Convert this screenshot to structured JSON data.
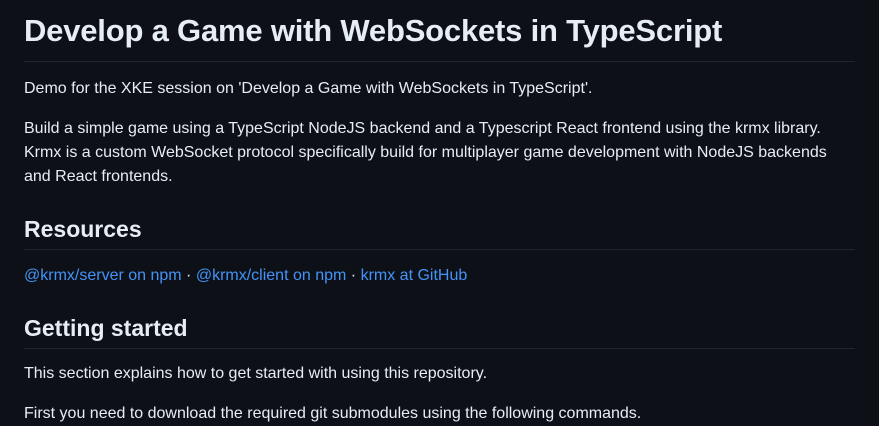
{
  "readme": {
    "title": "Develop a Game with WebSockets in TypeScript",
    "intro": "Demo for the XKE session on 'Develop a Game with WebSockets in TypeScript'.",
    "description": "Build a simple game using a TypeScript NodeJS backend and a Typescript React frontend using the krmx library. Krmx is a custom WebSocket protocol specifically build for multiplayer game development with NodeJS backends and React frontends.",
    "resources": {
      "heading": "Resources",
      "separator": " · ",
      "links": [
        {
          "label": "@krmx/server on npm"
        },
        {
          "label": "@krmx/client on npm"
        },
        {
          "label": "krmx at GitHub"
        }
      ]
    },
    "getting_started": {
      "heading": "Getting started",
      "paragraph1": "This section explains how to get started with using this repository.",
      "paragraph2": "First you need to download the required git submodules using the following commands."
    }
  },
  "colors": {
    "background": "#0d1117",
    "text": "#e6edf3",
    "link": "#4493f8",
    "divider": "#21262d"
  }
}
